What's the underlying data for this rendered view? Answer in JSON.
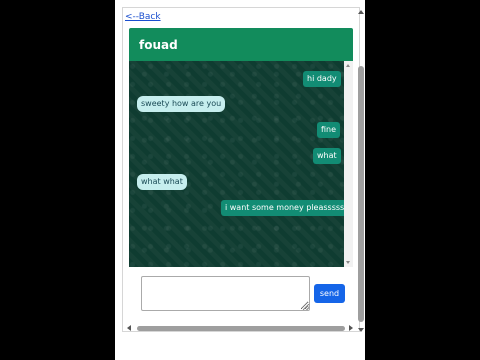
{
  "nav": {
    "back_label": "<--Back"
  },
  "chat": {
    "contact_name": "fouad",
    "messages": [
      {
        "text": "hi dady",
        "direction": "sent"
      },
      {
        "text": "sweety how are you",
        "direction": "received"
      },
      {
        "text": "fine",
        "direction": "sent"
      },
      {
        "text": "what",
        "direction": "sent"
      },
      {
        "text": "what what",
        "direction": "received"
      },
      {
        "text": "i want some money pleassssse",
        "direction": "sent"
      }
    ]
  },
  "composer": {
    "input_value": "",
    "send_label": "send"
  },
  "colors": {
    "header": "#128c5c",
    "chat_background": "#0f3c31",
    "sent_bubble": "#128c74",
    "received_bubble": "#c6eeee",
    "send_button": "#1565e8"
  }
}
